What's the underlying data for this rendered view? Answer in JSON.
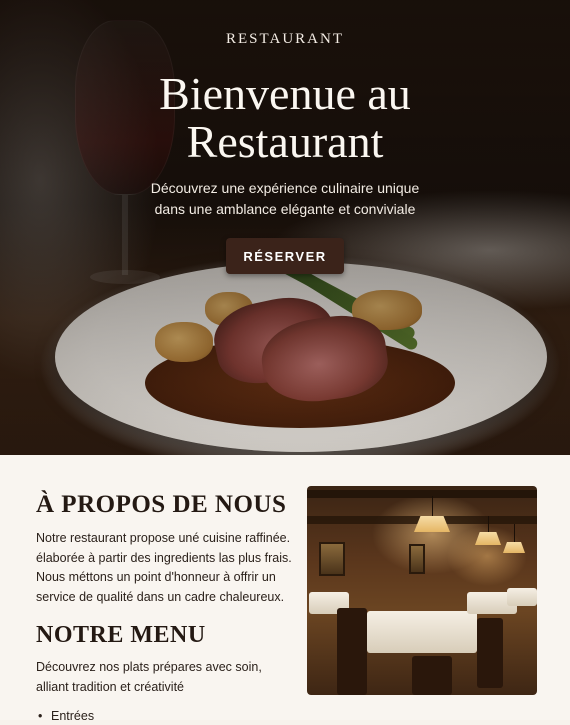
{
  "hero": {
    "eyebrow": "RESTAURANT",
    "title_line1": "Bienvenue au",
    "title_line2": "Restaurant",
    "subtitle_line1": "Découvrez une expérience culinaire unique",
    "subtitle_line2": "dans une amblance elégante et conviviale",
    "cta_label": "RÉSERVER"
  },
  "about": {
    "title": "À PROPOS DE NOUS",
    "text_lines": [
      "Notre restaurant propose uné cuisine raffinée.",
      "élaborée à partir des ingredients las plus frais.",
      "Nous méttons un point d'honneur à offrir un",
      "service de qualité dans un cadre chaleureux."
    ]
  },
  "menu": {
    "title": "NOTRE MENU",
    "text_lines": [
      "Découvrez nos plats prépares avec soin,",
      "alliant tradition et créativité"
    ],
    "items": [
      "Entrées"
    ]
  },
  "colors": {
    "accent": "#3b231a",
    "background": "#f9f5f0",
    "heading": "#241913"
  }
}
